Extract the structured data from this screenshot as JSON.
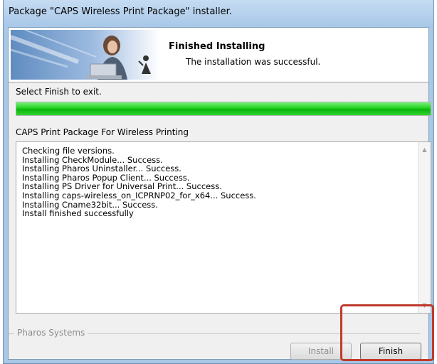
{
  "window": {
    "title": "Package \"CAPS Wireless Print Package\" installer."
  },
  "banner": {
    "heading": "Finished Installing",
    "subtitle": "The installation was successful."
  },
  "status": {
    "instruction": "Select Finish to exit.",
    "progress_percent": 100,
    "progress_color": "#1fd21f"
  },
  "package": {
    "name": "CAPS Print Package For Wireless Printing"
  },
  "log": {
    "lines": [
      "Checking file versions.",
      "Installing CheckModule... Success.",
      "Installing Pharos Uninstaller... Success.",
      "Installing Pharos Popup Client... Success.",
      "Installing PS Driver for Universal Print... Success.",
      "Installing caps-wireless_on_ICPRNP02_for_x64... Success.",
      "Installing Cname32bit... Success.",
      "Install finished successfully"
    ]
  },
  "footer": {
    "vendor": "Pharos Systems",
    "install_label": "Install",
    "finish_label": "Finish",
    "highlight_color": "#c0392b"
  }
}
